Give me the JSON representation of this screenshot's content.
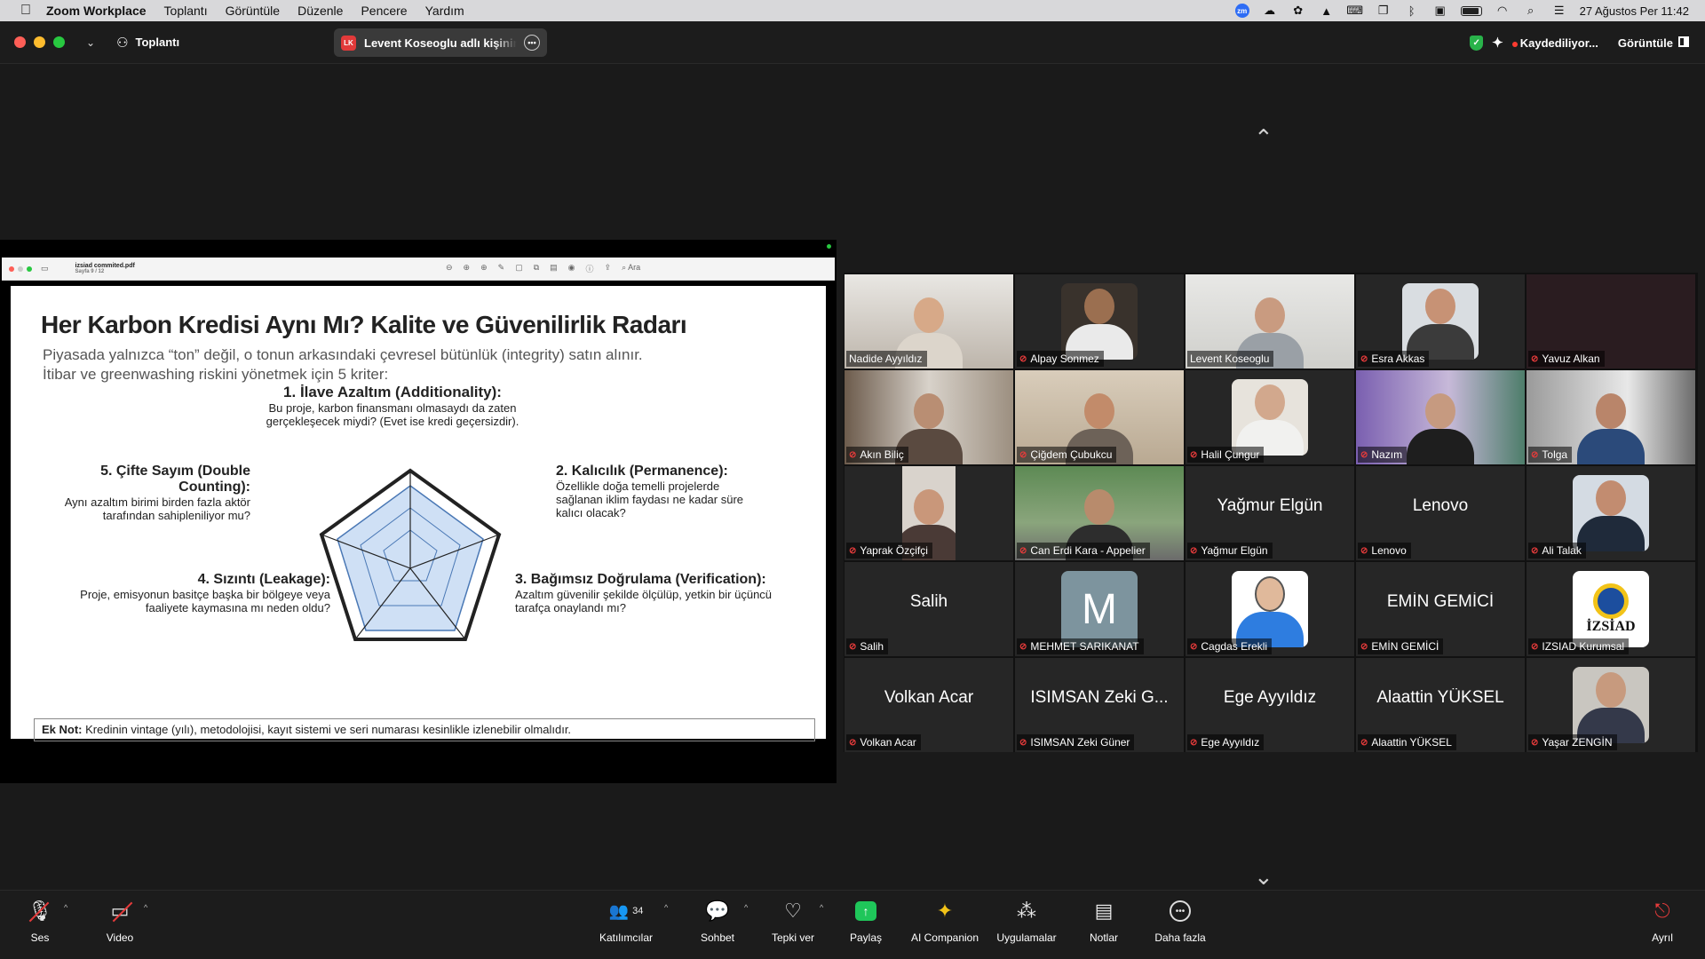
{
  "menubar": {
    "app_name": "Zoom Workplace",
    "items": [
      "Toplantı",
      "Görüntüle",
      "Düzenle",
      "Pencere",
      "Yardım"
    ],
    "datetime": "27 Ağustos Per  11:42"
  },
  "titlebar": {
    "meeting_label": "Toplantı",
    "share_badge": "LK",
    "share_text": "Levent Koseoglu adlı kişinin ekranı",
    "recording": "Kaydediliyor...",
    "view": "Görüntüle"
  },
  "pdf": {
    "filename": "izsiad commited.pdf",
    "page": "Sayfa 9 / 12",
    "search": "Ara"
  },
  "slide": {
    "title": "Her Karbon Kredisi Aynı Mı? Kalite ve Güvenilirlik Radarı",
    "subtitle_1": "Piyasada yalnızca “ton” değil, o tonun arkasındaki çevresel bütünlük (integrity) satın alınır.",
    "subtitle_2": "İtibar ve greenwashing riskini yönetmek için 5 kriter:",
    "c1_title": "1. İlave Azaltım (Additionality):",
    "c1_desc": "Bu proje, karbon finansmanı olmasaydı da zaten gerçekleşecek miydi? (Evet ise kredi geçersizdir).",
    "c2_title": "2. Kalıcılık (Permanence):",
    "c2_desc": "Özellikle doğa temelli projelerde sağlanan iklim faydası ne kadar süre kalıcı olacak?",
    "c3_title": "3. Bağımsız Doğrulama (Verification):",
    "c3_desc": "Azaltım güvenilir şekilde ölçülüp, yetkin bir üçüncü tarafça onaylandı mı?",
    "c4_title": "4. Sızıntı (Leakage):",
    "c4_desc": "Proje, emisyonun basitçe başka bir bölgeye veya faaliyete kaymasına mı neden oldu?",
    "c5_title": "5. Çifte Sayım (Double Counting):",
    "c5_desc": "Aynı azaltım birimi birden fazla aktör tarafından sahipleniliyor mu?",
    "note_label": "Ek Not:",
    "note_text": " Kredinin vintage (yılı), metodolojisi, kayıt sistemi ve seri numarası kesinlikle izlenebilir olmalıdır."
  },
  "participants": [
    {
      "name": "Nadide Ayyıldız",
      "video": true,
      "muted": false
    },
    {
      "name": "Alpay Sonmez",
      "video": true,
      "muted": true
    },
    {
      "name": "Levent Koseoglu",
      "video": true,
      "muted": false,
      "active": true
    },
    {
      "name": "Esra Akkas",
      "video": true,
      "muted": true
    },
    {
      "name": "Yavuz Alkan",
      "video": true,
      "muted": true
    },
    {
      "name": "Akın Biliç",
      "video": true,
      "muted": true
    },
    {
      "name": "Çiğdem Çubukcu",
      "video": true,
      "muted": true
    },
    {
      "name": "Halil Çungur",
      "video": true,
      "muted": true
    },
    {
      "name": "Nazım",
      "video": true,
      "muted": true
    },
    {
      "name": "Tolga",
      "video": true,
      "muted": true
    },
    {
      "name": "Yaprak Özçifçi",
      "video": true,
      "muted": true
    },
    {
      "name": "Can Erdi Kara - Appelier",
      "video": true,
      "muted": true
    },
    {
      "name": "Yağmur Elgün",
      "big": "Yağmur Elgün",
      "muted": true
    },
    {
      "name": "Lenovo",
      "big": "Lenovo",
      "muted": true
    },
    {
      "name": "Ali Talak",
      "video": true,
      "muted": true
    },
    {
      "name": "Salih",
      "big": "Salih",
      "muted": true
    },
    {
      "name": "MEHMET SARIKANAT",
      "avatar_letter": "M",
      "muted": true
    },
    {
      "name": "Cagdas Erekli",
      "avatar": true,
      "muted": true
    },
    {
      "name": "EMİN GEMİCİ",
      "big": "EMİN GEMİCİ",
      "muted": true
    },
    {
      "name": "IZSIAD Kurumsal",
      "logo_text": "İZSİAD",
      "muted": true
    },
    {
      "name": "Volkan Acar",
      "big": "Volkan Acar",
      "muted": true
    },
    {
      "name": "ISIMSAN  Zeki  Güner",
      "big": "ISIMSAN  Zeki  G...",
      "muted": true
    },
    {
      "name": "Ege Ayyıldız",
      "big": "Ege Ayyıldız",
      "muted": true
    },
    {
      "name": "Alaattin YÜKSEL",
      "big": "Alaattin YÜKSEL",
      "muted": true
    },
    {
      "name": "Yaşar ZENGİN",
      "video": true,
      "muted": true
    }
  ],
  "toolbar": {
    "audio": "Ses",
    "video": "Video",
    "participants": "Katılımcılar",
    "participants_count": "34",
    "chat": "Sohbet",
    "react": "Tepki ver",
    "share": "Paylaş",
    "ai": "AI Companion",
    "apps": "Uygulamalar",
    "notes": "Notlar",
    "more": "Daha fazla",
    "leave": "Ayrıl"
  }
}
